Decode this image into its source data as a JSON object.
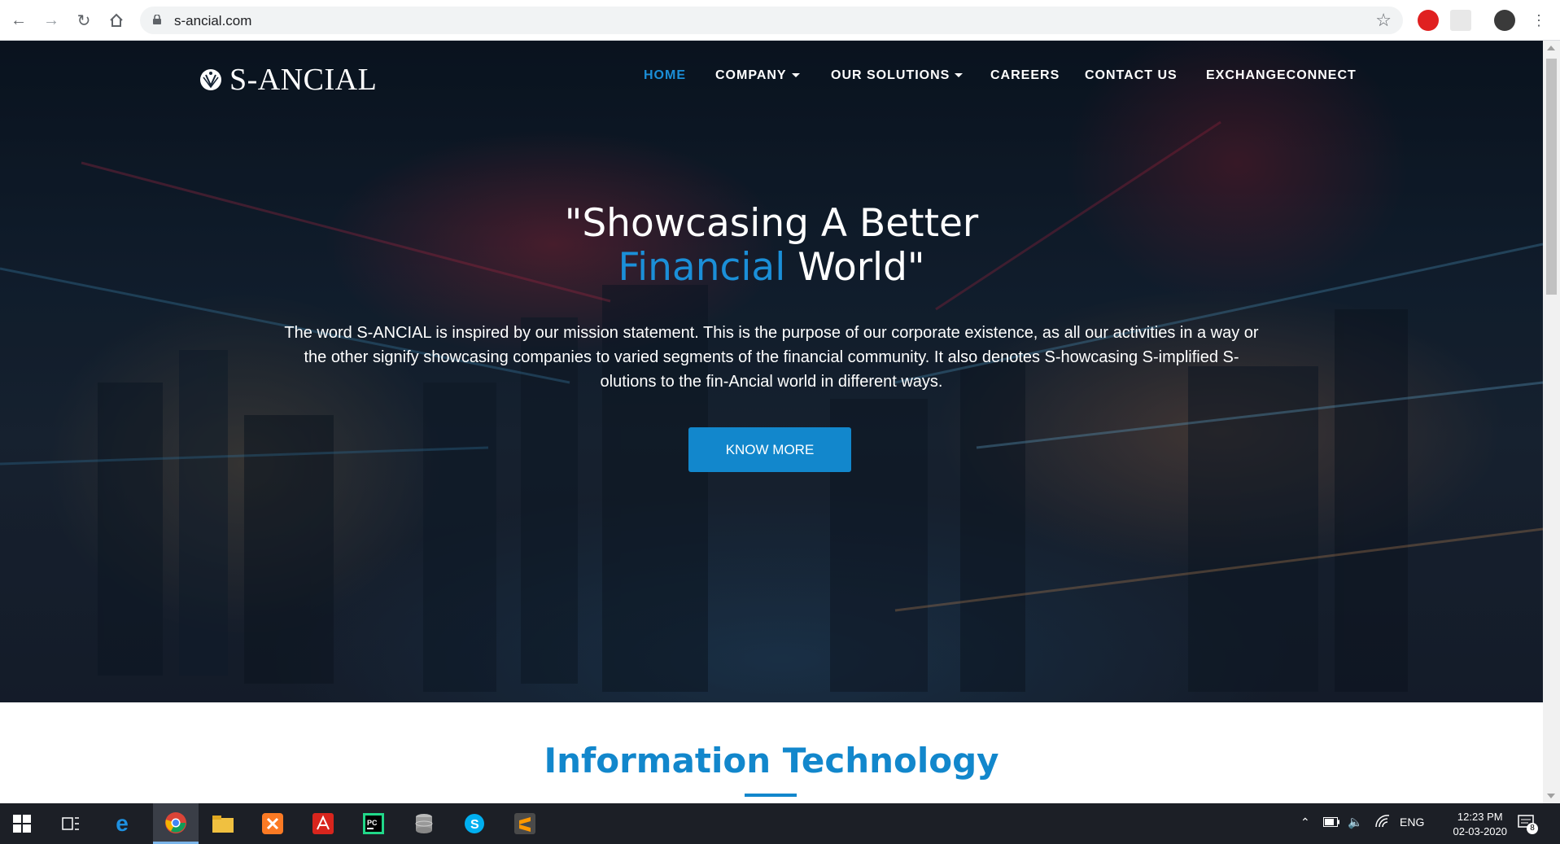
{
  "browser": {
    "url": "s-ancial.com"
  },
  "site": {
    "logo_text": "S-ANCIAL",
    "menu": [
      {
        "label": "HOME",
        "active": true
      },
      {
        "label": "COMPANY",
        "dropdown": true
      },
      {
        "label": "OUR SOLUTIONS",
        "dropdown": true
      },
      {
        "label": "CAREERS"
      },
      {
        "label": "CONTACT US"
      },
      {
        "label": "EXCHANGECONNECT"
      }
    ],
    "hero": {
      "headline_line1": "\"Showcasing A Better",
      "headline_accent": "Financial",
      "headline_line2_rest": " World\"",
      "description": "The word S-ANCIAL is inspired by our mission statement. This is the purpose of our corporate existence, as all our activities in a way or the other signify showcasing companies to varied segments of the financial community. It also denotes S-howcasing S-implified S-olutions to the fin-Ancial world in different ways.",
      "cta_label": "KNOW MORE"
    },
    "section_title": "Information Technology"
  },
  "taskbar": {
    "language": "ENG",
    "time": "12:23 PM",
    "date": "02-03-2020",
    "notification_count": "8"
  },
  "colors": {
    "accent": "#1b8fd8",
    "button": "#1287cc",
    "taskbar": "#1c1f26"
  }
}
